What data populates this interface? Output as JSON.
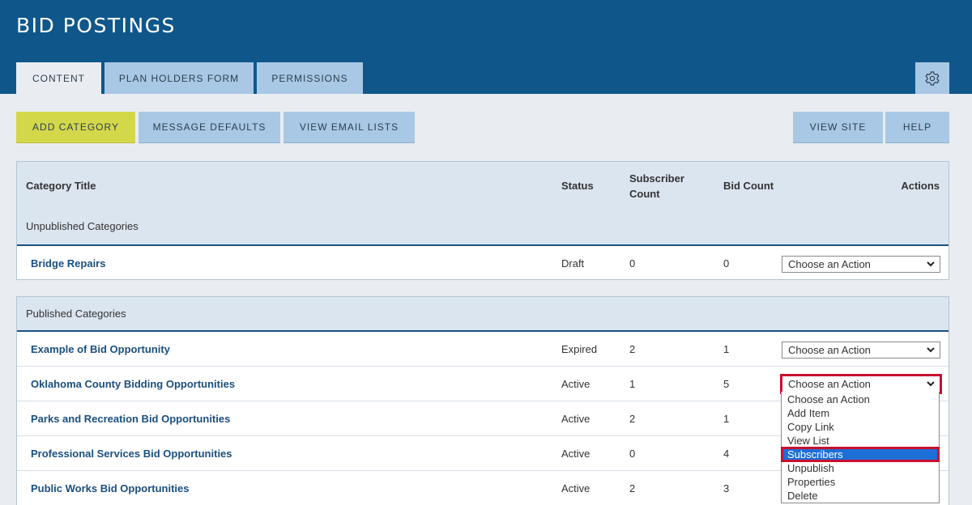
{
  "app": {
    "title": "BID POSTINGS"
  },
  "tabs": [
    {
      "label": "CONTENT",
      "active": true
    },
    {
      "label": "PLAN HOLDERS FORM",
      "active": false
    },
    {
      "label": "PERMISSIONS",
      "active": false
    }
  ],
  "settings_icon": "gear-icon",
  "toolbar": {
    "add_category": "ADD CATEGORY",
    "message_defaults": "MESSAGE DEFAULTS",
    "view_email_lists": "VIEW EMAIL LISTS",
    "view_site": "VIEW SITE",
    "help": "HELP"
  },
  "table": {
    "headers": {
      "title": "Category Title",
      "status": "Status",
      "subscriber_count": "Subscriber Count",
      "bid_count": "Bid Count",
      "actions": "Actions"
    },
    "unpublished_label": "Unpublished Categories",
    "published_label": "Published Categories",
    "unpublished_rows": [
      {
        "title": "Bridge Repairs",
        "status": "Draft",
        "subscribers": "0",
        "bids": "0",
        "action": "Choose an Action"
      }
    ],
    "published_rows": [
      {
        "title": "Example of Bid Opportunity",
        "status": "Expired",
        "subscribers": "2",
        "bids": "1",
        "action": "Choose an Action"
      },
      {
        "title": "Oklahoma County Bidding Opportunities",
        "status": "Active",
        "subscribers": "1",
        "bids": "5",
        "action": "Choose an Action"
      },
      {
        "title": "Parks and Recreation Bid Opportunities",
        "status": "Active",
        "subscribers": "2",
        "bids": "1",
        "action": ""
      },
      {
        "title": "Professional Services Bid Opportunities",
        "status": "Active",
        "subscribers": "0",
        "bids": "4",
        "action": ""
      },
      {
        "title": "Public Works Bid Opportunities",
        "status": "Active",
        "subscribers": "2",
        "bids": "3",
        "action": ""
      }
    ]
  },
  "action_menu": {
    "options": [
      "Choose an Action",
      "Add Item",
      "Copy Link",
      "View List",
      "Subscribers",
      "Unpublish",
      "Properties",
      "Delete"
    ],
    "highlighted": "Subscribers"
  },
  "colors": {
    "header_bg": "#0f578a",
    "tab_bg": "#a9c8e5",
    "primary_button": "#d3d84a",
    "link_text": "#1b4f7e",
    "highlight_outline": "#c8102e",
    "selected_option": "#1d6fd8"
  }
}
